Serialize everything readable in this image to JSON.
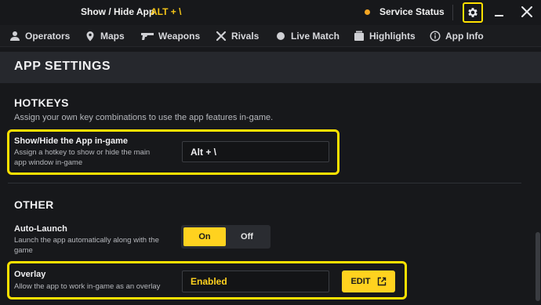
{
  "titlebar": {
    "title": "Show / Hide App",
    "hotkey": "ALT + \\",
    "status_label": "Service Status",
    "status_color": "#f5a623",
    "icons": [
      "gear-icon",
      "minimize-icon",
      "close-icon"
    ]
  },
  "nav": {
    "items": [
      {
        "label": "Operators",
        "icon": "operator-icon"
      },
      {
        "label": "Maps",
        "icon": "map-pin-icon"
      },
      {
        "label": "Weapons",
        "icon": "gun-icon"
      },
      {
        "label": "Rivals",
        "icon": "rivals-icon"
      },
      {
        "label": "Live Match",
        "icon": "live-dot-icon"
      },
      {
        "label": "Highlights",
        "icon": "film-icon"
      },
      {
        "label": "App Info",
        "icon": "info-icon"
      }
    ]
  },
  "section": {
    "title": "APP SETTINGS"
  },
  "hotkeys": {
    "title": "HOTKEYS",
    "description": "Assign your own key combinations to use the app features in-game.",
    "show_hide": {
      "label": "Show/Hide the App in-game",
      "description": "Assign a hotkey to show or hide the main app window in-game",
      "value": "Alt + \\"
    }
  },
  "other": {
    "title": "OTHER",
    "auto_launch": {
      "label": "Auto-Launch",
      "description": "Launch the app automatically along with the game",
      "on_label": "On",
      "off_label": "Off",
      "selected": "On"
    },
    "overlay": {
      "label": "Overlay",
      "description": "Allow the app to work in-game as an overlay",
      "value": "Enabled",
      "edit_label": "EDIT"
    }
  },
  "colors": {
    "accent": "#ffd21f",
    "highlight_border": "#ffe100",
    "background": "#17181b",
    "header_bg": "#26282d"
  }
}
